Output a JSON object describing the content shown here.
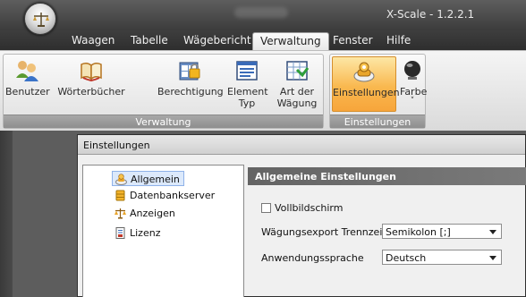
{
  "window": {
    "title": "X-Scale - 1.2.2.1"
  },
  "tabs": [
    {
      "label": "Waagen"
    },
    {
      "label": "Tabelle"
    },
    {
      "label": "Wägebericht"
    },
    {
      "label": "Verwaltung",
      "active": true
    },
    {
      "label": "Fenster"
    },
    {
      "label": "Hilfe"
    }
  ],
  "ribbon": {
    "groups": [
      {
        "label": "Verwaltung",
        "buttons": [
          {
            "label": "Benutzer",
            "icon": "users-icon"
          },
          {
            "label": "Wörterbücher",
            "icon": "book-icon"
          },
          {
            "label": "Berechtigung",
            "icon": "permission-icon"
          },
          {
            "label": "Element Typ",
            "line1": "Element",
            "line2": "Typ",
            "icon": "element-type-icon"
          },
          {
            "label": "Art der Wägung",
            "line1": "Art der",
            "line2": "Wägung",
            "icon": "weighing-type-icon"
          }
        ]
      },
      {
        "label": "Einstellungen",
        "buttons": [
          {
            "label": "Einstellungen",
            "icon": "settings-icon",
            "selected": true
          },
          {
            "label": "Farbe",
            "icon": "color-ball-icon",
            "dropdown": "˅"
          }
        ]
      }
    ]
  },
  "dialog": {
    "title": "Einstellungen",
    "tree": [
      {
        "label": "Allgemein",
        "icon": "general-settings-icon",
        "selected": true
      },
      {
        "label": "Datenbankserver",
        "icon": "database-icon"
      },
      {
        "label": "Anzeigen",
        "icon": "scale-icon"
      },
      {
        "label": "Lizenz",
        "icon": "license-icon"
      }
    ],
    "panel": {
      "heading": "Allgemeine Einstellungen",
      "fullscreen_label": "Vollbildschirm",
      "fullscreen_checked": false,
      "separator_label": "Wägungsexport Trennzeichen",
      "separator_value": "Semikolon [;]",
      "language_label": "Anwendungssprache",
      "language_value": "Deutsch"
    }
  },
  "colors": {
    "accent_selected": "#f9b84f",
    "group_label_bg": "#9a9a9a",
    "panel_header_bg": "#6c6c6c"
  }
}
